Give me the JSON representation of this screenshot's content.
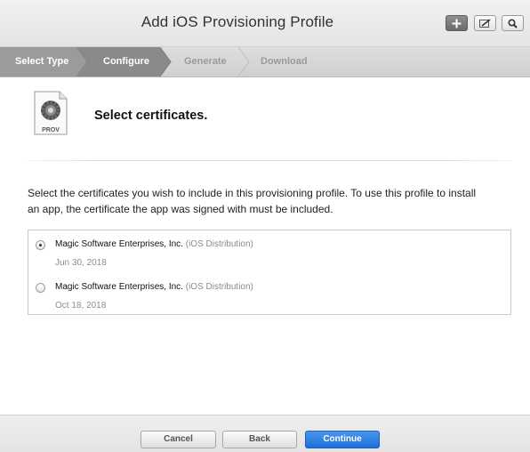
{
  "header": {
    "title": "Add iOS Provisioning Profile",
    "buttons": [
      {
        "icon": "plus-icon"
      },
      {
        "icon": "edit-icon"
      },
      {
        "icon": "search-icon"
      }
    ]
  },
  "steps": [
    {
      "label": "Select Type",
      "state": "completed"
    },
    {
      "label": "Configure",
      "state": "current"
    },
    {
      "label": "Generate",
      "state": "upcoming"
    },
    {
      "label": "Download",
      "state": "upcoming"
    }
  ],
  "section": {
    "icon_label": "PROV",
    "title": "Select certificates.",
    "description": "Select the certificates you wish to include in this provisioning profile. To use this profile to install an app, the certificate the app was signed with must be included."
  },
  "certificates": [
    {
      "name": "Magic Software Enterprises, Inc.",
      "type": "(iOS Distribution)",
      "date": "Jun 30, 2018",
      "selected": true
    },
    {
      "name": "Magic Software Enterprises, Inc.",
      "type": "(iOS Distribution)",
      "date": "Oct 18, 2018",
      "selected": false
    }
  ],
  "footer": {
    "cancel_label": "Cancel",
    "back_label": "Back",
    "continue_label": "Continue"
  },
  "colors": {
    "primary_button": "#1b6fd8",
    "step_completed": "#9b9b9b",
    "step_current": "#8a8a8a"
  }
}
